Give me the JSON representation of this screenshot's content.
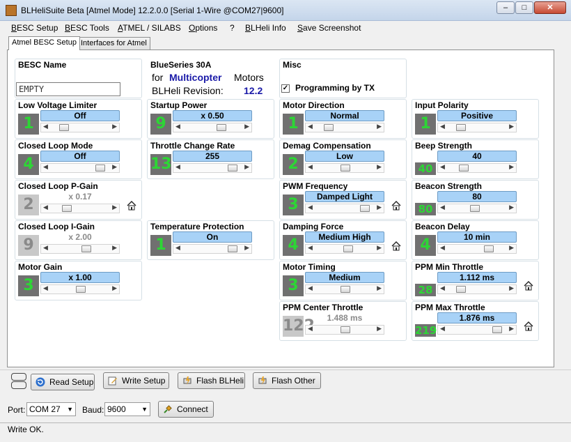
{
  "window": {
    "title": "BLHeliSuite Beta [Atmel Mode] 12.2.0.0 [Serial 1-Wire @COM27|9600]"
  },
  "menu": [
    "BESC Setup",
    "BESC Tools",
    "ATMEL / SILABS",
    "Options",
    "?",
    "BLHeli Info",
    "Save Screenshot"
  ],
  "tabs": [
    "Atmel BESC Setup",
    "Interfaces for Atmel"
  ],
  "besc_name": {
    "title": "BESC Name",
    "value": "EMPTY"
  },
  "info": {
    "title": "BlueSeries 30A",
    "for": "for",
    "mode": "Multicopter",
    "motors": "Motors",
    "revision_label": "BLHeli Revision:",
    "revision": "12.2"
  },
  "misc": {
    "title": "Misc",
    "checkbox_label": "Programming by TX",
    "checked": true
  },
  "params": {
    "low_voltage_limiter": {
      "title": "Low Voltage Limiter",
      "value": "Off",
      "num": "1",
      "pos": 0.2
    },
    "closed_loop_mode": {
      "title": "Closed Loop Mode",
      "value": "Off",
      "num": "4",
      "pos": 0.85
    },
    "closed_loop_p_gain": {
      "title": "Closed Loop P-Gain",
      "value": "x 0.17",
      "num": "2",
      "pos": 0.25
    },
    "closed_loop_i_gain": {
      "title": "Closed Loop I-Gain",
      "value": "x 2.00",
      "num": "9",
      "pos": 0.6
    },
    "motor_gain": {
      "title": "Motor Gain",
      "value": "x 1.00",
      "num": "3",
      "pos": 0.5
    },
    "startup_power": {
      "title": "Startup Power",
      "value": "x 0.50",
      "num": "9",
      "pos": 0.65
    },
    "throttle_change_rate": {
      "title": "Throttle Change  Rate",
      "value": "255",
      "num": "13",
      "pos": 0.85
    },
    "temperature_protection": {
      "title": "Temperature Protection",
      "value": "On",
      "num": "1",
      "pos": 0.85
    },
    "motor_direction": {
      "title": "Motor Direction",
      "value": "Normal",
      "num": "1",
      "pos": 0.2
    },
    "demag_compensation": {
      "title": "Demag Compensation",
      "value": "Low",
      "num": "2",
      "pos": 0.5
    },
    "pwm_frequency": {
      "title": "PWM Frequency",
      "value": "Damped Light",
      "num": "3",
      "pos": 0.85
    },
    "damping_force": {
      "title": "Damping Force",
      "value": "Medium High",
      "num": "4",
      "pos": 0.55
    },
    "motor_timing": {
      "title": "Motor Timing",
      "value": "Medium",
      "num": "3",
      "pos": 0.5
    },
    "ppm_center_throttle": {
      "title": "PPM Center Throttle",
      "value": "1.488 ms",
      "num": "122",
      "pos": 0.5
    },
    "input_polarity": {
      "title": "Input Polarity",
      "value": "Positive",
      "num": "1",
      "pos": 0.2
    },
    "beep_strength": {
      "title": "Beep Strength",
      "value": "40",
      "num": "40",
      "pos": 0.25
    },
    "beacon_strength": {
      "title": "Beacon Strength",
      "value": "80",
      "num": "80",
      "pos": 0.45
    },
    "beacon_delay": {
      "title": "Beacon Delay",
      "value": "10 min",
      "num": "4",
      "pos": 0.7
    },
    "ppm_min_throttle": {
      "title": "PPM Min Throttle",
      "value": "1.112 ms",
      "num": "28",
      "pos": 0.2
    },
    "ppm_max_throttle": {
      "title": "PPM Max Throttle",
      "value": "1.876 ms",
      "num": "219",
      "pos": 0.85
    }
  },
  "buttons": {
    "read": "Read Setup",
    "write": "Write Setup",
    "flash_blheli": "Flash BLHeli",
    "flash_other": "Flash Other",
    "connect": "Connect"
  },
  "port": {
    "label": "Port:",
    "value": "COM 27"
  },
  "baud": {
    "label": "Baud:",
    "value": "9600"
  },
  "status": "Write OK.",
  "colors": {
    "value_bg": "#a8d2f7",
    "digit": "#2dd635",
    "digit_bg": "#707070",
    "brand_blue": "#1a1aa8"
  }
}
